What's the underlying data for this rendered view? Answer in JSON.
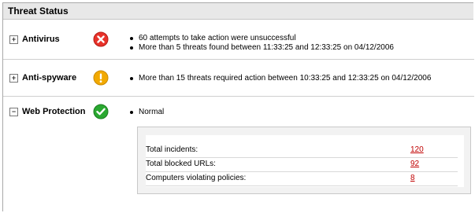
{
  "panel": {
    "title": "Threat Status"
  },
  "rows": [
    {
      "name": "Antivirus",
      "toggle": "+",
      "status": "error",
      "messages": [
        "60 attempts to take action were unsuccessful",
        "More than 5 threats found between 11:33:25 and 12:33:25 on 04/12/2006"
      ]
    },
    {
      "name": "Anti-spyware",
      "toggle": "+",
      "status": "warning",
      "messages": [
        "More than 15 threats required action between 10:33:25 and 12:33:25 on 04/12/2006"
      ]
    },
    {
      "name": "Web Protection",
      "toggle": "−",
      "status": "ok",
      "messages": [
        "Normal"
      ]
    }
  ],
  "stats": [
    {
      "label": "Total incidents:",
      "value": "120"
    },
    {
      "label": "Total blocked URLs:",
      "value": "92"
    },
    {
      "label": "Computers violating policies:",
      "value": "8"
    }
  ],
  "colors": {
    "error": "#e8322a",
    "warning": "#f2a900",
    "ok": "#2aa830",
    "link": "#c00000"
  },
  "icons": {
    "error": "x-circle-icon",
    "warning": "exclamation-circle-icon",
    "ok": "check-circle-icon"
  }
}
